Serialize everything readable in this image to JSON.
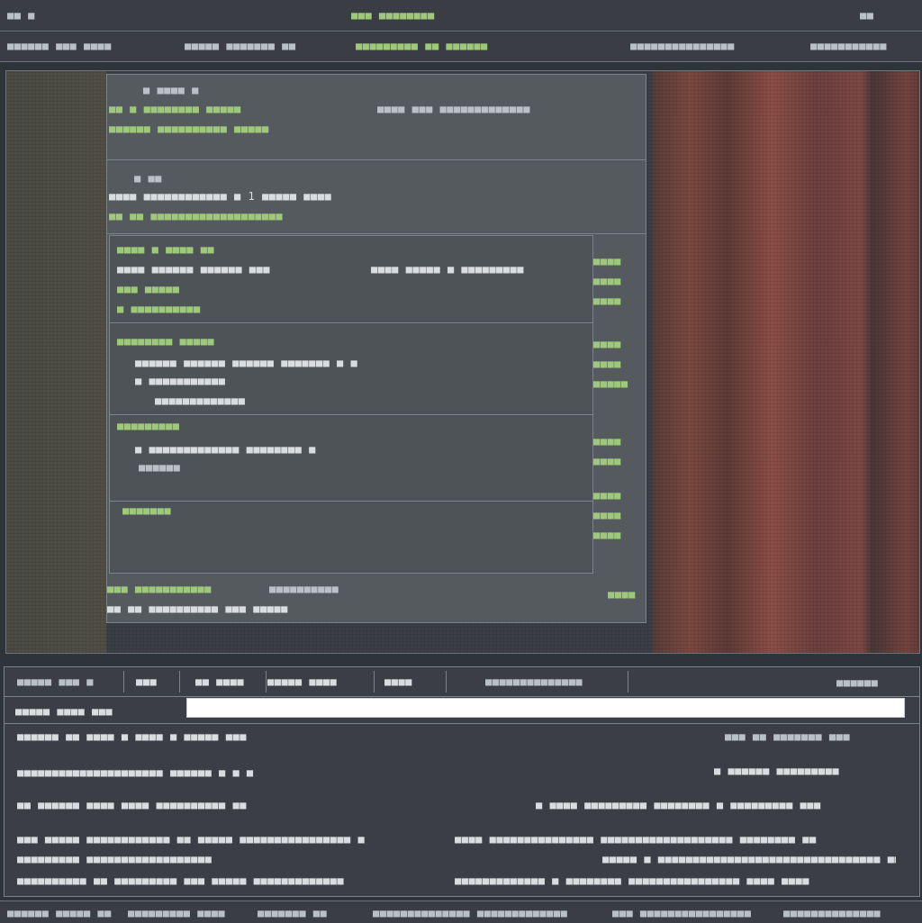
{
  "titlebar": {
    "left_label": "■■ ■",
    "title": "■■■ ■■■■■■■■",
    "right_label": "■■"
  },
  "menubar": {
    "items": [
      "■■■■■■ ■■■ ■■■■",
      "■■■■■ ■■■■■■■ ■■",
      "■■■■■■■■■ ■■ ■■■■■■",
      "■■■■■■■■■■■■■■■",
      "■■■■■■■■■■■"
    ]
  },
  "dialog": {
    "section1": {
      "line1": "■   ■■■■  ■",
      "line2a": "■■  ■  ■■■■■■■■   ■■■■■",
      "line2b": "■■■■  ■■■  ■■■■■■■■■■■■■",
      "line3a": "■■■■■■  ■■■■■■■■■■  ■■■■■"
    },
    "section2": {
      "line1": "■  ■■",
      "line2a": "■■■■  ■■■■■■■■■■■■  ■  1 ■■■■■ ■■■■",
      "line2b": "■■■■■■■■■■■  ■■■■",
      "line3": "■■  ■■  ■■■■■■■■■■■■■■■■■■■"
    },
    "inner_panel": {
      "row1": {
        "line1": "■■■■ ■  ■■■■  ■■",
        "line2a": "■■■■  ■■■■■■  ■■■■■■  ■■■",
        "line2b": "■■■■  ■■■■■  ■ ■■■■■■■■■",
        "line3": "■■■  ■■■■■",
        "line4": "■  ■■■■■■■■■■"
      },
      "row2": {
        "line1": "■■■■■■■■ ■■■■■",
        "line2": "■■■■■■  ■■■■■■ ■■■■■■  ■■■■■■■ ■ ■",
        "line3": "■ ■■■■■■■■■■■",
        "line4": "■■■■■■■■■■■■■"
      },
      "row3": {
        "line1": "■■■■■■■■■",
        "line2": "■  ■■■■■■■■■■■■■  ■■■■■■■■  ■",
        "line3": "■■■■■■"
      },
      "row4": {
        "line1": "■■■■■■■"
      },
      "side_labels": [
        "■■■■",
        "■■■■",
        "■■■■",
        "■■■■",
        "■■■■",
        "■■■■■",
        "■■■■",
        "■■■■",
        "■■■■",
        "■■■■",
        "■■■■"
      ]
    },
    "footer": {
      "line1a": "■■■  ■■■■■■■■■■■",
      "line1b": "■■■■■■■■■■",
      "line2": "■■ ■■ ■■■■■■■■■■ ■■■ ■■■■■",
      "right": "■■■■"
    }
  },
  "bottom_panel": {
    "tabs": [
      "■■■■■ ■■■ ■",
      "■■■",
      "■■ ■■■■",
      "■■■■■ ■■■■",
      "■■■■"
    ],
    "tab_right": "■■■■■■■■■■■■■■",
    "corner": "■■■■■■",
    "input_label": "■■■■■ ■■■■  ■■■",
    "input_value": "",
    "row1_left": "■■■■■■ ■■ ■■■■ ■ ■■■■ ■  ■■■■■ ■■■",
    "row1_right": "■■■ ■■  ■■■■■■■  ■■■",
    "row2_left": "■■■■■■■■■■■■■■■■■■■■■ ■■■■■■  ■  ■ ■",
    "row2_right": "■ ■■■■■■  ■■■■■■■■■",
    "row3_left": "■■ ■■■■■■ ■■■■  ■■■■  ■■■■■■■■■■ ■■",
    "row3_right": "■  ■■■■  ■■■■■■■■■   ■■■■■■■■ ■ ■■■■■■■■■  ■■■",
    "row4_left": "■■■  ■■■■■ ■■■■■■■■■■■■ ■■ ■■■■■  ■■■■■■■■■■■■■■■■  ■",
    "row4_right": "■■■■  ■■■■■■■■■■■■■■■ ■■■■■■■■■■■■■■■■■■■ ■■■■■■■■  ■■",
    "row5_left": "■■■■■■■■■ ■■■■■■■■■■■■■■■■■■",
    "row5_right": "■■■■■ ■  ■■■■■■■■■■■■■■■■■■■■■■■■■■■■■■■■  ■■",
    "row6_left": "■■■■■■■■■■ ■■ ■■■■■■■■■ ■■■  ■■■■■  ■■■■■■■■■■■■■",
    "row6_right": "■■■■■■■■■■■■■  ■ ■■■■■■■■ ■■■■■■■■■■■■■■■■  ■■■■ ■■■■"
  },
  "statusbar": {
    "items": [
      "■■■■■■ ■■■■■ ■■",
      "■■■■■■■■■ ■■■■",
      "■■■■■■■ ■■",
      "■■■■■■■■■■■■■■ ■■■■■■■■■■■■■",
      "■■■ ■■■■■■■■■■■■■■■■",
      "■■■■■■■■■■■■■■"
    ]
  },
  "colors": {
    "accent_green": "#9fc97a",
    "panel": "#555a5e",
    "desktop_red": "#7a4940"
  }
}
